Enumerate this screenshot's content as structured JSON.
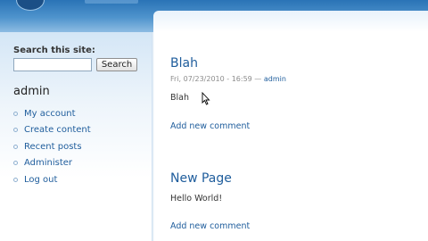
{
  "sidebar": {
    "search_label": "Search this site:",
    "search_value": "",
    "search_button": "Search",
    "user_block_title": "admin",
    "nav_items": [
      {
        "label": "My account"
      },
      {
        "label": "Create content"
      },
      {
        "label": "Recent posts"
      },
      {
        "label": "Administer"
      },
      {
        "label": "Log out"
      }
    ]
  },
  "nodes": [
    {
      "title": "Blah",
      "date": "Fri, 07/23/2010 - 16:59",
      "separator": " — ",
      "author": "admin",
      "body": "Blah",
      "add_comment": "Add new comment"
    },
    {
      "title": "New Page",
      "body": "Hello World!",
      "add_comment": "Add new comment"
    }
  ],
  "icons": {
    "logo": "drupal-logo-icon",
    "cursor": "mouse-pointer-icon"
  },
  "colors": {
    "header_blue": "#2a73b6",
    "link_blue": "#1f5d9c"
  }
}
